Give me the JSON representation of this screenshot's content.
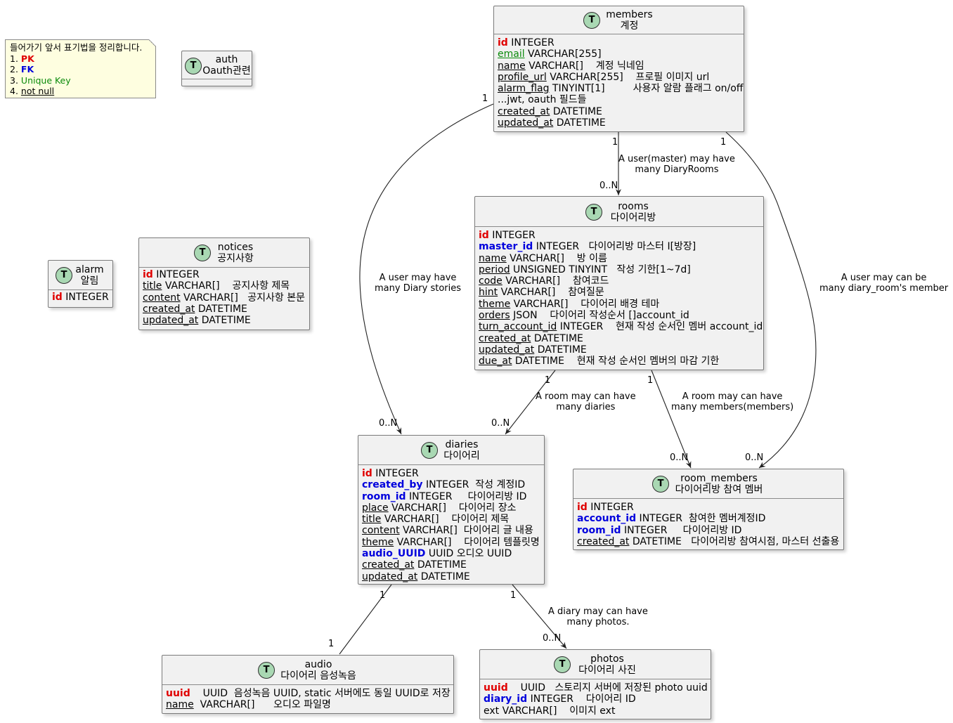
{
  "note": {
    "title": "들어가기 앞서 표기법을 정리합니다.",
    "items": [
      {
        "num": "1.",
        "text": "PK"
      },
      {
        "num": "2.",
        "text": "FK"
      },
      {
        "num": "3.",
        "text": "Unique Key"
      },
      {
        "num": "4.",
        "text": "not null"
      }
    ]
  },
  "badge": "T",
  "entities": {
    "members": {
      "name": "members",
      "label": "계정",
      "fields": [
        {
          "name": "id",
          "type": " INTEGER",
          "kind": "pk"
        },
        {
          "name": "email",
          "type": " VARCHAR[255]",
          "kind": "uk"
        },
        {
          "name": "name",
          "type": " VARCHAR[]    계정 닉네임",
          "kind": "nn"
        },
        {
          "name": "profile_url",
          "type": " VARCHAR[255]    프로필 이미지 url",
          "kind": "nn"
        },
        {
          "name": "alarm_flag",
          "type": " TINYINT[1]         사용자 알람 플래그 on/off",
          "kind": "nn"
        },
        {
          "name": "",
          "type": "...jwt, oauth 필드들",
          "kind": "plain"
        },
        {
          "name": "created_at",
          "type": " DATETIME",
          "kind": "nn"
        },
        {
          "name": "updated_at",
          "type": " DATETIME",
          "kind": "nn"
        }
      ]
    },
    "auth": {
      "name": "auth",
      "label": "Oauth관련",
      "fields": []
    },
    "rooms": {
      "name": "rooms",
      "label": "다이어리방",
      "fields": [
        {
          "name": "id",
          "type": " INTEGER",
          "kind": "pk"
        },
        {
          "name": "master_id",
          "type": " INTEGER   다이어리방 마스터 I[방장]",
          "kind": "fk"
        },
        {
          "name": "name",
          "type": " VARCHAR[]    방 이름",
          "kind": "nn"
        },
        {
          "name": "period",
          "type": " UNSIGNED TINYINT   작성 기한[1~7d]",
          "kind": "nn"
        },
        {
          "name": "code",
          "type": " VARCHAR[]    참여코드",
          "kind": "nn"
        },
        {
          "name": "hint",
          "type": " VARCHAR[]    참여질문",
          "kind": "nn"
        },
        {
          "name": "theme",
          "type": " VARCHAR[]    다이어리 배경 테마",
          "kind": "nn"
        },
        {
          "name": "orders",
          "type": " JSON    다이어리 작성순서 []account_id",
          "kind": "nn"
        },
        {
          "name": "turn_account_id",
          "type": " INTEGER    현재 작성 순서인 멤버 account_id",
          "kind": "nn"
        },
        {
          "name": "created_at",
          "type": " DATETIME",
          "kind": "nn"
        },
        {
          "name": "updated_at",
          "type": " DATETIME",
          "kind": "nn"
        },
        {
          "name": "due_at",
          "type": " DATETIME    현재 작성 순서인 멤버의 마감 기한",
          "kind": "nn"
        }
      ]
    },
    "notices": {
      "name": "notices",
      "label": "공지사항",
      "fields": [
        {
          "name": "id",
          "type": " INTEGER",
          "kind": "pk"
        },
        {
          "name": "title",
          "type": " VARCHAR[]    공지사항 제목",
          "kind": "nn"
        },
        {
          "name": "content",
          "type": " VARCHAR[]   공지사항 본문",
          "kind": "nn"
        },
        {
          "name": "created_at",
          "type": " DATETIME",
          "kind": "nn"
        },
        {
          "name": "updated_at",
          "type": " DATETIME",
          "kind": "nn"
        }
      ]
    },
    "alarm": {
      "name": "alarm",
      "label": "알림",
      "fields": [
        {
          "name": "id",
          "type": " INTEGER",
          "kind": "pk"
        }
      ]
    },
    "diaries": {
      "name": "diaries",
      "label": "다이어리",
      "fields": [
        {
          "name": "id",
          "type": " INTEGER",
          "kind": "pk"
        },
        {
          "name": "created_by",
          "type": " INTEGER  작성 계정ID",
          "kind": "fk"
        },
        {
          "name": "room_id",
          "type": " INTEGER     다이어리방 ID",
          "kind": "fk"
        },
        {
          "name": "place",
          "type": " VARCHAR[]    다이어리 장소",
          "kind": "nn"
        },
        {
          "name": "title",
          "type": " VARCHAR[]    다이어리 제목",
          "kind": "nn"
        },
        {
          "name": "content",
          "type": " VARCHAR[]  다이어리 글 내용",
          "kind": "nn"
        },
        {
          "name": "theme",
          "type": " VARCHAR[]    다이어리 템플릿명",
          "kind": "nn"
        },
        {
          "name": "audio_UUID",
          "type": " UUID 오디오 UUID",
          "kind": "fk"
        },
        {
          "name": "created_at",
          "type": " DATETIME",
          "kind": "nn"
        },
        {
          "name": "updated_at",
          "type": " DATETIME",
          "kind": "nn"
        }
      ]
    },
    "room_members": {
      "name": "room_members",
      "label": "다이어리방 참여 멤버",
      "fields": [
        {
          "name": "id",
          "type": " INTEGER",
          "kind": "pk"
        },
        {
          "name": "account_id",
          "type": " INTEGER  참여한 멤버계정ID",
          "kind": "fk"
        },
        {
          "name": "room_id",
          "type": " INTEGER     다이어리방 ID",
          "kind": "fk"
        },
        {
          "name": "created_at",
          "type": " DATETIME   다이어리방 참여시점, 마스터 선출용",
          "kind": "nn"
        }
      ]
    },
    "audio": {
      "name": "audio",
      "label": "다이어리 음성녹음",
      "fields": [
        {
          "name": "uuid",
          "type": "    UUID  음성녹음 UUID, static 서버에도 동일 UUID로 저장",
          "kind": "pk"
        },
        {
          "name": "name",
          "type": "  VARCHAR[]      오디오 파일명",
          "kind": "nn"
        }
      ]
    },
    "photos": {
      "name": "photos",
      "label": "다이어리 사진",
      "fields": [
        {
          "name": "uuid",
          "type": "    UUID   스토리지 서버에 저장된 photo uuid",
          "kind": "pk"
        },
        {
          "name": "diary_id",
          "type": " INTEGER    다이어리 ID",
          "kind": "fk"
        },
        {
          "name": "",
          "type": "ext VARCHAR[]    이미지 ext",
          "kind": "plain"
        }
      ]
    }
  },
  "relations": {
    "members_rooms": {
      "label": "A user(master) may have\nmany DiaryRooms",
      "from_card": "1",
      "to_card": "0..N"
    },
    "members_diaries": {
      "label": "A user may have\nmany Diary stories",
      "from_card": "1",
      "to_card": "0..N"
    },
    "members_room_members": {
      "label": "A user may can be\nmany diary_room's member",
      "from_card": "1",
      "to_card": "0..N"
    },
    "rooms_diaries": {
      "label": "A room may can have\nmany diaries",
      "from_card": "1",
      "to_card": "0..N"
    },
    "rooms_room_members": {
      "label": "A room may can have\nmany members(members)",
      "from_card": "1",
      "to_card": "0..N"
    },
    "diaries_audio": {
      "from_card": "1",
      "to_card": "1"
    },
    "diaries_photos": {
      "label": "A diary may can have\nmany photos.",
      "from_card": "1",
      "to_card": "0..N"
    }
  }
}
